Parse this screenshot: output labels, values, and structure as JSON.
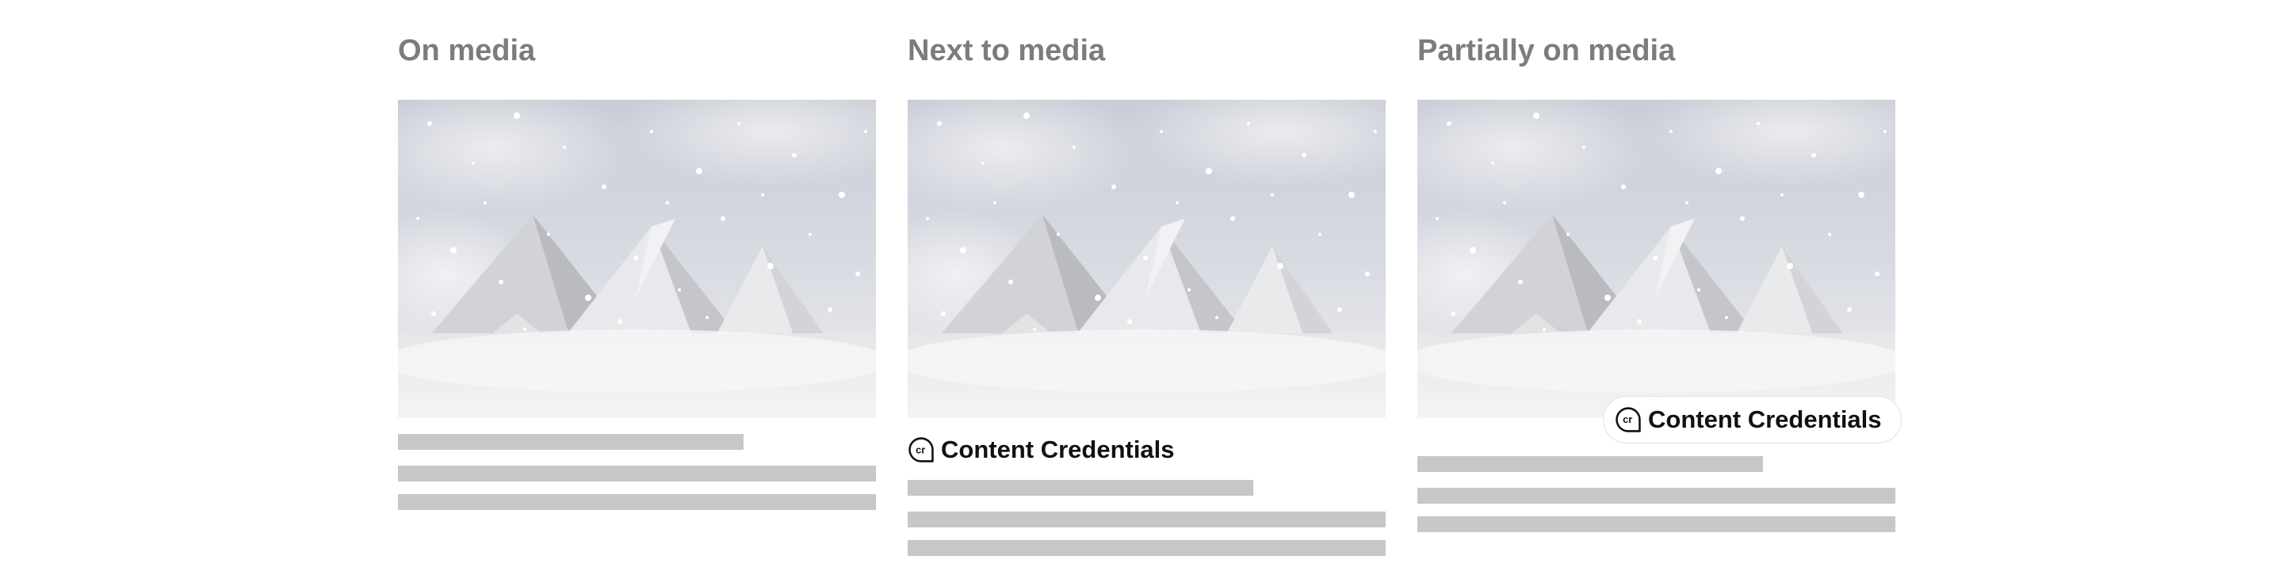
{
  "columns": [
    {
      "heading": "On media",
      "cr_placement": "on-media"
    },
    {
      "heading": "Next to media",
      "cr_placement": "next-to-media",
      "cr_label": "Content Credentials"
    },
    {
      "heading": "Partially on media",
      "cr_placement": "partially-on-media",
      "cr_label": "Content Credentials"
    }
  ],
  "media_image": "snow-covered-pyramids",
  "cr_icon": "content-credentials-icon",
  "colors": {
    "heading": "#7c7c7c",
    "placeholder_bar": "#c7c7c7",
    "label": "#111111",
    "background": "#ffffff"
  }
}
